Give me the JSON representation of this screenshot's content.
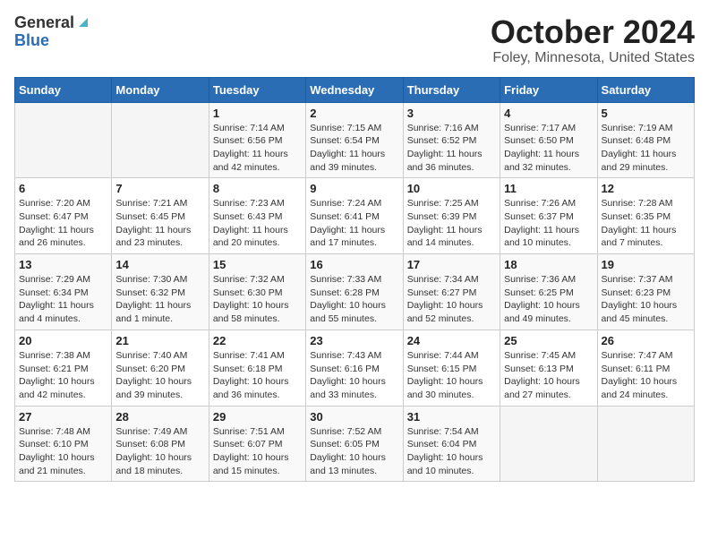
{
  "header": {
    "logo_general": "General",
    "logo_blue": "Blue",
    "title": "October 2024",
    "subtitle": "Foley, Minnesota, United States"
  },
  "weekdays": [
    "Sunday",
    "Monday",
    "Tuesday",
    "Wednesday",
    "Thursday",
    "Friday",
    "Saturday"
  ],
  "weeks": [
    [
      {
        "day": "",
        "info": ""
      },
      {
        "day": "",
        "info": ""
      },
      {
        "day": "1",
        "info": "Sunrise: 7:14 AM\nSunset: 6:56 PM\nDaylight: 11 hours and 42 minutes."
      },
      {
        "day": "2",
        "info": "Sunrise: 7:15 AM\nSunset: 6:54 PM\nDaylight: 11 hours and 39 minutes."
      },
      {
        "day": "3",
        "info": "Sunrise: 7:16 AM\nSunset: 6:52 PM\nDaylight: 11 hours and 36 minutes."
      },
      {
        "day": "4",
        "info": "Sunrise: 7:17 AM\nSunset: 6:50 PM\nDaylight: 11 hours and 32 minutes."
      },
      {
        "day": "5",
        "info": "Sunrise: 7:19 AM\nSunset: 6:48 PM\nDaylight: 11 hours and 29 minutes."
      }
    ],
    [
      {
        "day": "6",
        "info": "Sunrise: 7:20 AM\nSunset: 6:47 PM\nDaylight: 11 hours and 26 minutes."
      },
      {
        "day": "7",
        "info": "Sunrise: 7:21 AM\nSunset: 6:45 PM\nDaylight: 11 hours and 23 minutes."
      },
      {
        "day": "8",
        "info": "Sunrise: 7:23 AM\nSunset: 6:43 PM\nDaylight: 11 hours and 20 minutes."
      },
      {
        "day": "9",
        "info": "Sunrise: 7:24 AM\nSunset: 6:41 PM\nDaylight: 11 hours and 17 minutes."
      },
      {
        "day": "10",
        "info": "Sunrise: 7:25 AM\nSunset: 6:39 PM\nDaylight: 11 hours and 14 minutes."
      },
      {
        "day": "11",
        "info": "Sunrise: 7:26 AM\nSunset: 6:37 PM\nDaylight: 11 hours and 10 minutes."
      },
      {
        "day": "12",
        "info": "Sunrise: 7:28 AM\nSunset: 6:35 PM\nDaylight: 11 hours and 7 minutes."
      }
    ],
    [
      {
        "day": "13",
        "info": "Sunrise: 7:29 AM\nSunset: 6:34 PM\nDaylight: 11 hours and 4 minutes."
      },
      {
        "day": "14",
        "info": "Sunrise: 7:30 AM\nSunset: 6:32 PM\nDaylight: 11 hours and 1 minute."
      },
      {
        "day": "15",
        "info": "Sunrise: 7:32 AM\nSunset: 6:30 PM\nDaylight: 10 hours and 58 minutes."
      },
      {
        "day": "16",
        "info": "Sunrise: 7:33 AM\nSunset: 6:28 PM\nDaylight: 10 hours and 55 minutes."
      },
      {
        "day": "17",
        "info": "Sunrise: 7:34 AM\nSunset: 6:27 PM\nDaylight: 10 hours and 52 minutes."
      },
      {
        "day": "18",
        "info": "Sunrise: 7:36 AM\nSunset: 6:25 PM\nDaylight: 10 hours and 49 minutes."
      },
      {
        "day": "19",
        "info": "Sunrise: 7:37 AM\nSunset: 6:23 PM\nDaylight: 10 hours and 45 minutes."
      }
    ],
    [
      {
        "day": "20",
        "info": "Sunrise: 7:38 AM\nSunset: 6:21 PM\nDaylight: 10 hours and 42 minutes."
      },
      {
        "day": "21",
        "info": "Sunrise: 7:40 AM\nSunset: 6:20 PM\nDaylight: 10 hours and 39 minutes."
      },
      {
        "day": "22",
        "info": "Sunrise: 7:41 AM\nSunset: 6:18 PM\nDaylight: 10 hours and 36 minutes."
      },
      {
        "day": "23",
        "info": "Sunrise: 7:43 AM\nSunset: 6:16 PM\nDaylight: 10 hours and 33 minutes."
      },
      {
        "day": "24",
        "info": "Sunrise: 7:44 AM\nSunset: 6:15 PM\nDaylight: 10 hours and 30 minutes."
      },
      {
        "day": "25",
        "info": "Sunrise: 7:45 AM\nSunset: 6:13 PM\nDaylight: 10 hours and 27 minutes."
      },
      {
        "day": "26",
        "info": "Sunrise: 7:47 AM\nSunset: 6:11 PM\nDaylight: 10 hours and 24 minutes."
      }
    ],
    [
      {
        "day": "27",
        "info": "Sunrise: 7:48 AM\nSunset: 6:10 PM\nDaylight: 10 hours and 21 minutes."
      },
      {
        "day": "28",
        "info": "Sunrise: 7:49 AM\nSunset: 6:08 PM\nDaylight: 10 hours and 18 minutes."
      },
      {
        "day": "29",
        "info": "Sunrise: 7:51 AM\nSunset: 6:07 PM\nDaylight: 10 hours and 15 minutes."
      },
      {
        "day": "30",
        "info": "Sunrise: 7:52 AM\nSunset: 6:05 PM\nDaylight: 10 hours and 13 minutes."
      },
      {
        "day": "31",
        "info": "Sunrise: 7:54 AM\nSunset: 6:04 PM\nDaylight: 10 hours and 10 minutes."
      },
      {
        "day": "",
        "info": ""
      },
      {
        "day": "",
        "info": ""
      }
    ]
  ]
}
